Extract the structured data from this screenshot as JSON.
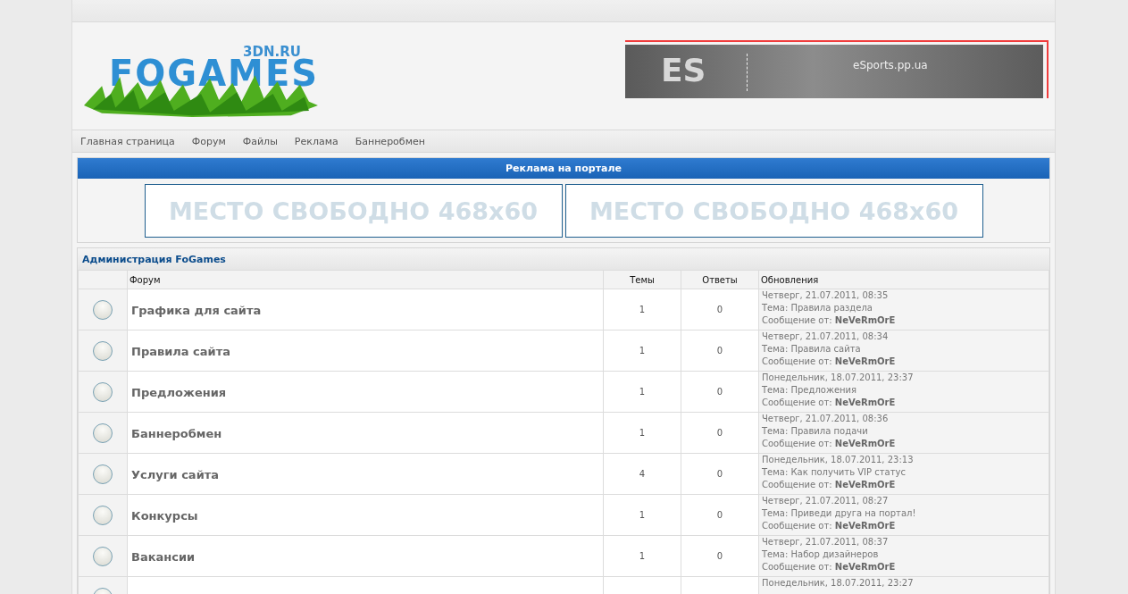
{
  "logo": {
    "title": "FOGAMES",
    "domain": "3DN.RU"
  },
  "banner": {
    "mark": "ES",
    "site": "eSports.pp.ua"
  },
  "nav": [
    {
      "label": "Главная страница"
    },
    {
      "label": "Форум"
    },
    {
      "label": "Файлы"
    },
    {
      "label": "Реклама"
    },
    {
      "label": "Баннеробмен"
    }
  ],
  "ads": {
    "title": "Реклама на портале",
    "slots": [
      "МЕСТО СВОБОДНО 468x60",
      "МЕСТО СВОБОДНО 468x60"
    ]
  },
  "category": {
    "title": "Администрация FoGames",
    "columns": [
      "Форум",
      "Темы",
      "Ответы",
      "Обновления"
    ],
    "rows": [
      {
        "name": "Графика для сайта",
        "topics": "1",
        "replies": "0",
        "date": "Четверг, 21.07.2011, 08:35",
        "topic": "Тема: Правила раздела",
        "author": "Сообщение от: **NeVeRmOrE**"
      },
      {
        "name": "Правила сайта",
        "topics": "1",
        "replies": "0",
        "date": "Четверг, 21.07.2011, 08:34",
        "topic": "Тема: Правила сайта",
        "author": "Сообщение от: **NeVeRmOrE**"
      },
      {
        "name": "Предложения",
        "topics": "1",
        "replies": "0",
        "date": "Понедельник, 18.07.2011, 23:37",
        "topic": "Тема: Предложения",
        "author": "Сообщение от: **NeVeRmOrE**"
      },
      {
        "name": "Баннеробмен",
        "topics": "1",
        "replies": "0",
        "date": "Четверг, 21.07.2011, 08:36",
        "topic": "Тема: Правила подачи",
        "author": "Сообщение от: **NeVeRmOrE**"
      },
      {
        "name": "Услуги сайта",
        "topics": "4",
        "replies": "0",
        "date": "Понедельник, 18.07.2011, 23:13",
        "topic": "Тема: Как получить VIP статус",
        "author": "Сообщение от: **NeVeRmOrE**"
      },
      {
        "name": "Конкурсы",
        "topics": "1",
        "replies": "0",
        "date": "Четверг, 21.07.2011, 08:27",
        "topic": "Тема: Приведи друга на портал!",
        "author": "Сообщение от: **NeVeRmOrE**"
      },
      {
        "name": "Вакансии",
        "topics": "1",
        "replies": "0",
        "date": "Четверг, 21.07.2011, 08:37",
        "topic": "Тема: Набор дизайнеров",
        "author": "Сообщение от: **NeVeRmOrE**"
      },
      {
        "date": "Понедельник, 18.07.2011, 23:27"
      }
    ]
  }
}
